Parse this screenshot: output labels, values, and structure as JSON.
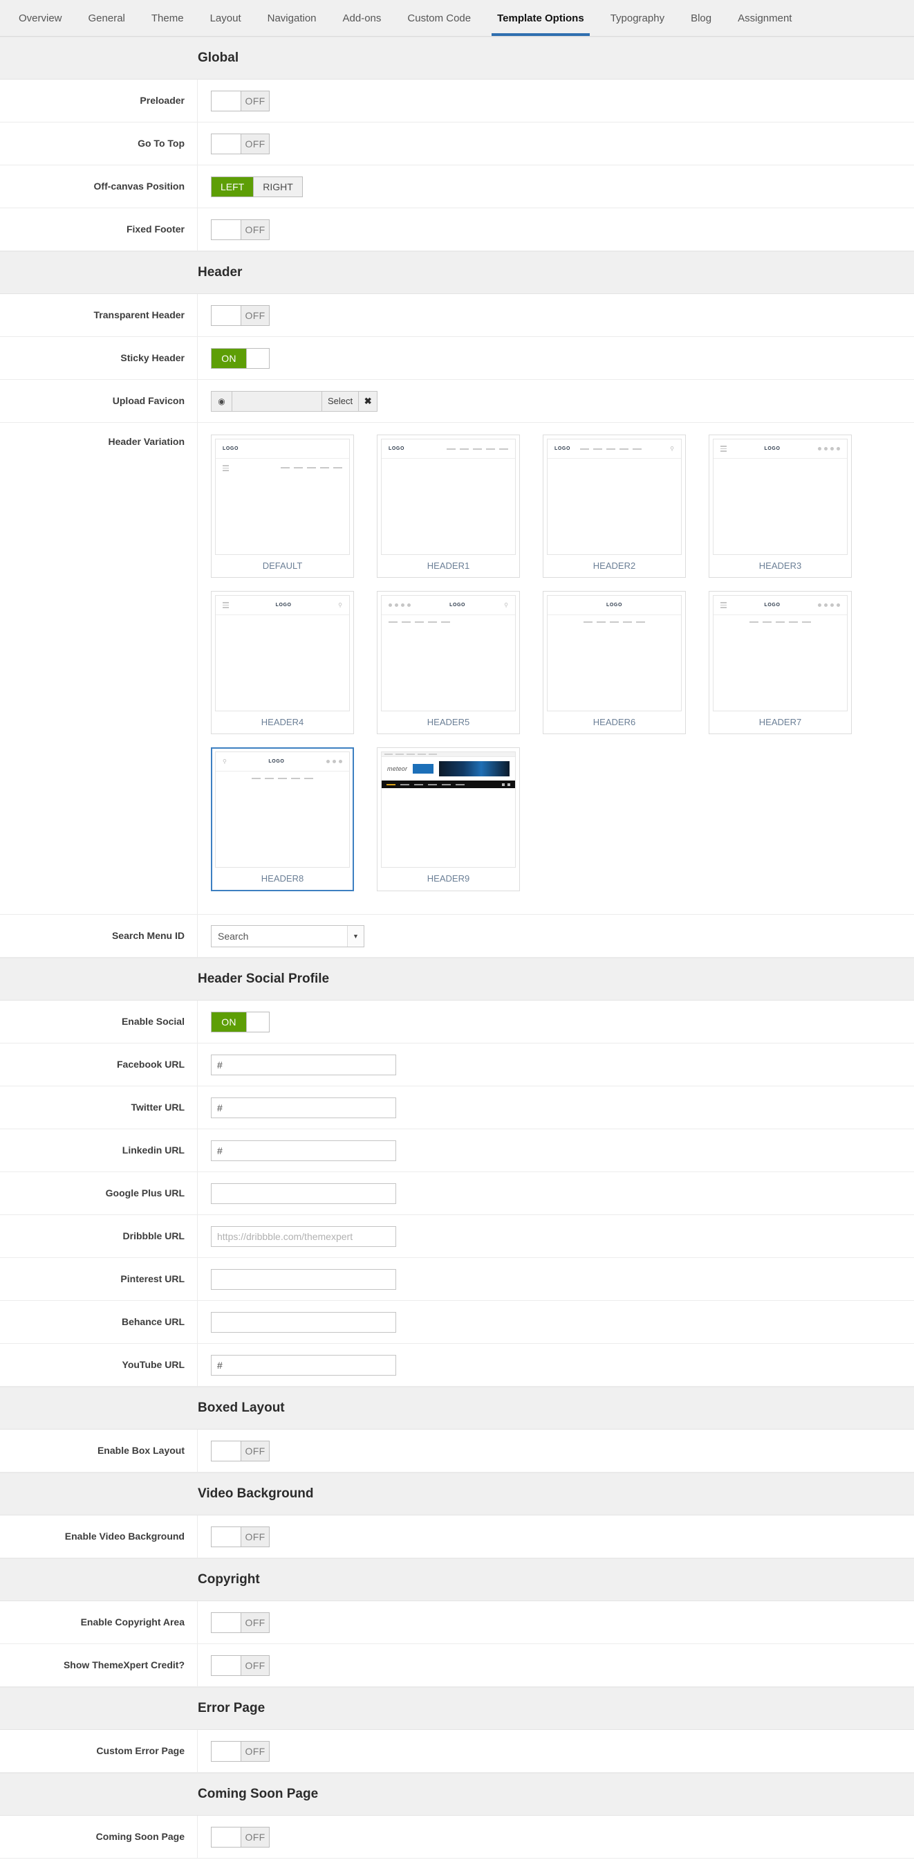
{
  "tabs": [
    {
      "label": "Overview",
      "active": false
    },
    {
      "label": "General",
      "active": false
    },
    {
      "label": "Theme",
      "active": false
    },
    {
      "label": "Layout",
      "active": false
    },
    {
      "label": "Navigation",
      "active": false
    },
    {
      "label": "Add-ons",
      "active": false
    },
    {
      "label": "Custom Code",
      "active": false
    },
    {
      "label": "Template Options",
      "active": true
    },
    {
      "label": "Typography",
      "active": false
    },
    {
      "label": "Blog",
      "active": false
    },
    {
      "label": "Assignment",
      "active": false
    }
  ],
  "colors": {
    "accent_green": "#5d9e06",
    "active_tab_underline": "#2f6faf",
    "selected_card_border": "#3d7fc1",
    "section_header_bg": "#f0f0f0"
  },
  "sections": {
    "global": {
      "title": "Global",
      "preloader": {
        "label": "Preloader",
        "state": "OFF"
      },
      "go_to_top": {
        "label": "Go To Top",
        "state": "OFF"
      },
      "offcanvas": {
        "label": "Off-canvas Position",
        "option_left": "LEFT",
        "option_right": "RIGHT",
        "selected": "LEFT"
      },
      "fixed_footer": {
        "label": "Fixed Footer",
        "state": "OFF"
      }
    },
    "header": {
      "title": "Header",
      "transparent_header": {
        "label": "Transparent Header",
        "state": "OFF"
      },
      "sticky_header": {
        "label": "Sticky Header",
        "state": "ON"
      },
      "upload_favicon": {
        "label": "Upload Favicon",
        "value": "",
        "select_label": "Select",
        "eye_icon": "eye-icon",
        "clear_icon": "close-icon"
      },
      "header_variation": {
        "label": "Header Variation",
        "selected": "HEADER8",
        "options": [
          {
            "name": "DEFAULT",
            "layout": "default"
          },
          {
            "name": "HEADER1",
            "layout": "logo-left-menu-right"
          },
          {
            "name": "HEADER2",
            "layout": "logo-left-menu-search"
          },
          {
            "name": "HEADER3",
            "layout": "burger-logo-dots"
          },
          {
            "name": "HEADER4",
            "layout": "burger-logo-search"
          },
          {
            "name": "HEADER5",
            "layout": "dots-logo-search"
          },
          {
            "name": "HEADER6",
            "layout": "logo-center-menu-below"
          },
          {
            "name": "HEADER7",
            "layout": "burger-logo-dots-menu"
          },
          {
            "name": "HEADER8",
            "layout": "search-logo-dots-menu"
          },
          {
            "name": "HEADER9",
            "layout": "screenshot"
          }
        ]
      },
      "search_menu_id": {
        "label": "Search Menu ID",
        "value": "Search"
      }
    },
    "header_social": {
      "title": "Header Social Profile",
      "enable_social": {
        "label": "Enable Social",
        "state": "ON"
      },
      "fields": [
        {
          "label": "Facebook URL",
          "value": "#",
          "placeholder": ""
        },
        {
          "label": "Twitter URL",
          "value": "#",
          "placeholder": ""
        },
        {
          "label": "Linkedin URL",
          "value": "#",
          "placeholder": ""
        },
        {
          "label": "Google Plus URL",
          "value": "",
          "placeholder": ""
        },
        {
          "label": "Dribbble URL",
          "value": "",
          "placeholder": "https://dribbble.com/themexpert"
        },
        {
          "label": "Pinterest URL",
          "value": "",
          "placeholder": ""
        },
        {
          "label": "Behance URL",
          "value": "",
          "placeholder": ""
        },
        {
          "label": "YouTube URL",
          "value": "#",
          "placeholder": ""
        }
      ]
    },
    "boxed_layout": {
      "title": "Boxed Layout",
      "enable_box_layout": {
        "label": "Enable Box Layout",
        "state": "OFF"
      }
    },
    "video_background": {
      "title": "Video Background",
      "enable_video_background": {
        "label": "Enable Video Background",
        "state": "OFF"
      }
    },
    "copyright": {
      "title": "Copyright",
      "enable_copyright_area": {
        "label": "Enable Copyright Area",
        "state": "OFF"
      },
      "show_themexpert_credit": {
        "label": "Show ThemeXpert Credit?",
        "state": "OFF"
      }
    },
    "error_page": {
      "title": "Error Page",
      "custom_error_page": {
        "label": "Custom Error Page",
        "state": "OFF"
      }
    },
    "coming_soon": {
      "title": "Coming Soon Page",
      "coming_soon_page": {
        "label": "Coming Soon Page",
        "state": "OFF"
      }
    }
  },
  "thumb_logo_text": "LOGO"
}
